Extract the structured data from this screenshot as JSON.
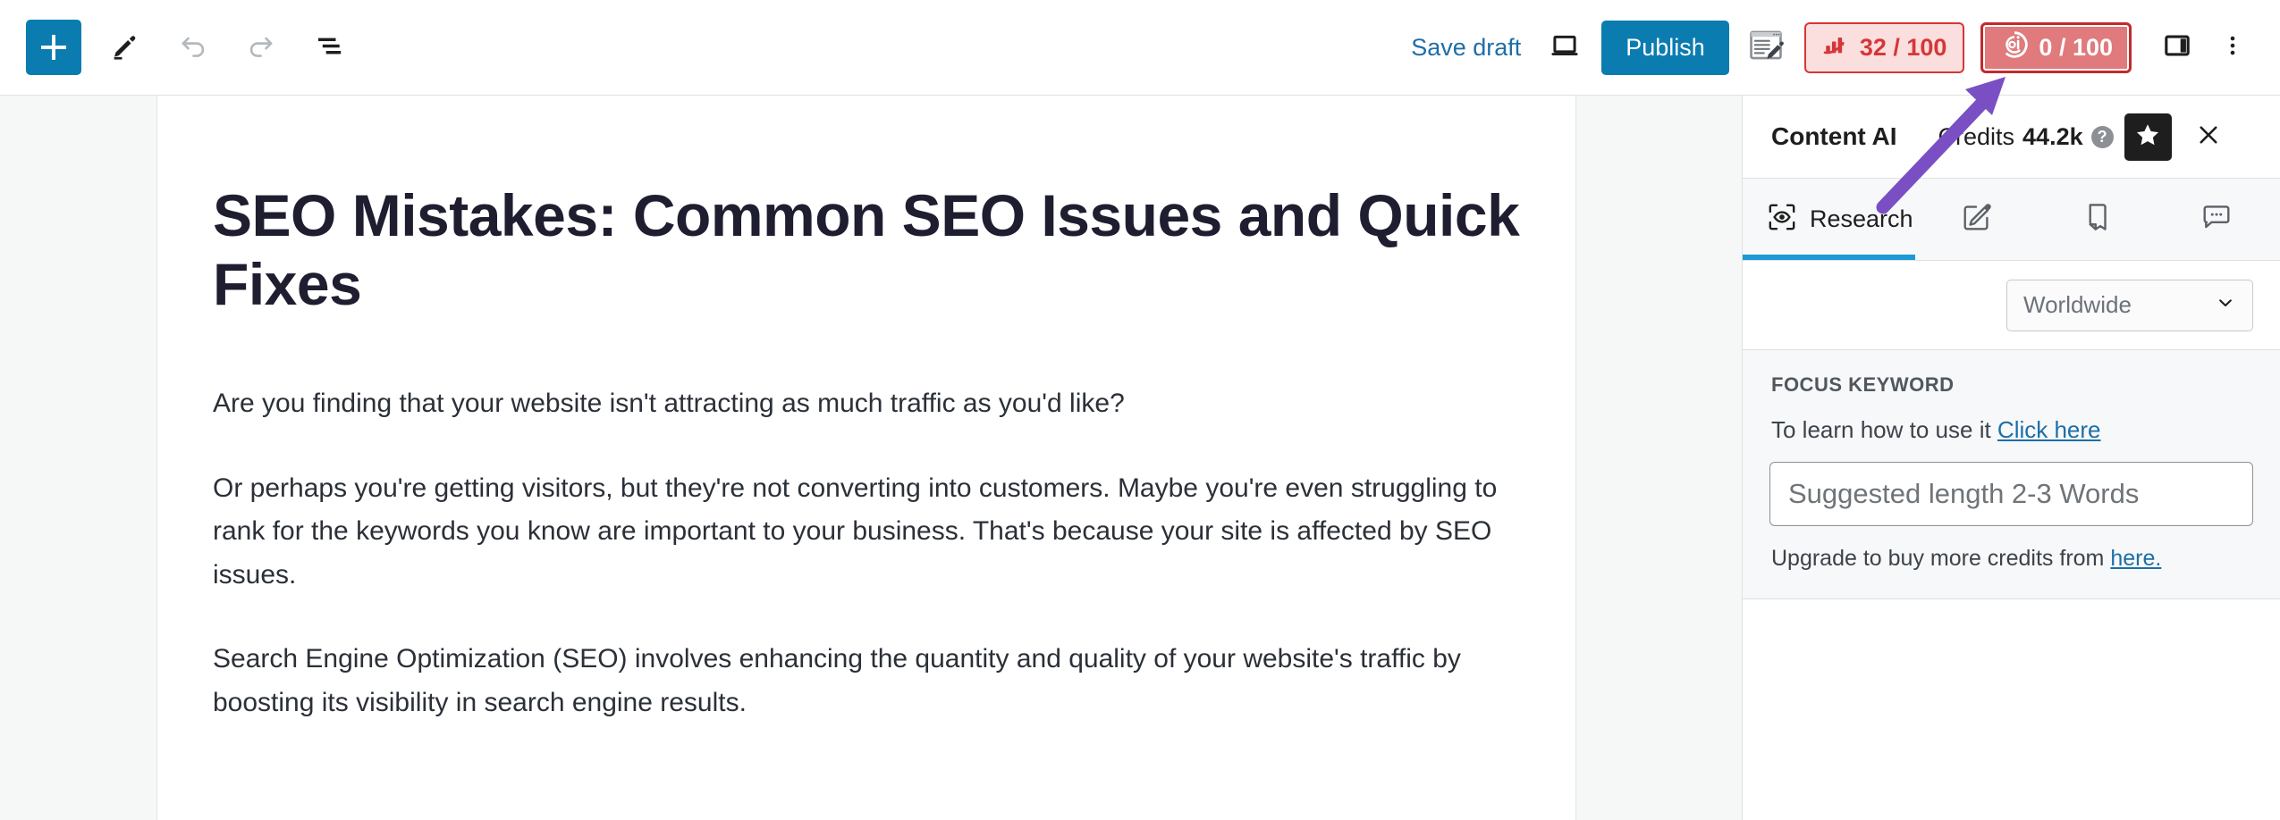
{
  "toolbar": {
    "add_block_label": "+",
    "icons": {
      "add_block": "plus-icon",
      "edit_tool": "pencil-icon",
      "undo": "undo-arrow-icon",
      "redo": "redo-arrow-icon",
      "list_view": "list-view-icon",
      "preview": "laptop-preview-icon",
      "rank_math": "rank-math-icon",
      "settings_sidebar": "sidebar-toggle-icon",
      "options": "three-dots-icon"
    },
    "save_draft_label": "Save draft",
    "publish_label": "Publish",
    "seo_score": {
      "value": "32 / 100",
      "icon": "seo-bar-chart-icon",
      "bg_color": "#fbdede",
      "border_color": "#d63638",
      "text_color": "#d63638"
    },
    "ai_score": {
      "value": "0 / 100",
      "icon": "content-ai-circle-icon",
      "bg_color": "#e07a7c",
      "border_color": "#c32a2c",
      "text_color": "#ffffff"
    }
  },
  "post": {
    "title": "SEO Mistakes: Common SEO Issues and Quick Fixes",
    "paragraphs": [
      "Are you finding that your website isn't attracting as much traffic as you'd like?",
      "Or perhaps you're getting visitors, but they're not converting into customers. Maybe you're even struggling to rank for the keywords you know are important to your business. That's because your site is affected by SEO issues.",
      "Search Engine Optimization (SEO) involves enhancing the quantity and quality of your website's traffic by boosting its visibility in search engine results."
    ]
  },
  "content_ai": {
    "panel_title": "Content AI",
    "credits_label": "Credits",
    "credits_value": "44.2k",
    "help_glyph": "?",
    "star_icon": "star-icon",
    "close_icon": "close-icon",
    "tabs": [
      {
        "label": "Research",
        "icon": "research-scan-eye-icon",
        "active": true
      },
      {
        "label": "",
        "icon": "write-pencil-square-icon",
        "active": false
      },
      {
        "label": "",
        "icon": "document-page-icon",
        "active": false
      },
      {
        "label": "",
        "icon": "chat-bubble-icon",
        "active": false
      }
    ],
    "region": {
      "selected": "Worldwide",
      "chevron_icon": "chevron-down-icon"
    },
    "focus_keyword": {
      "heading": "FOCUS KEYWORD",
      "help_prefix": "To learn how to use it ",
      "help_link": "Click here",
      "input_placeholder": "Suggested length 2-3 Words",
      "input_value": "",
      "footer_prefix": "Upgrade to buy more credits from ",
      "footer_link": "here."
    }
  },
  "annotation": {
    "arrow_color": "#7a4fc4",
    "points_to": "ai-score-badge"
  }
}
